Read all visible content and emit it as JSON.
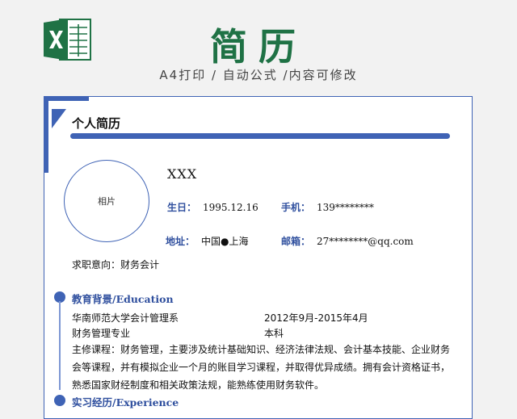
{
  "banner": {
    "title": "简历",
    "subtitle": "A4打印 / 自动公式 /内容可修改",
    "colors": {
      "excel_green": "#1f7245",
      "accent_blue": "#3f63b5"
    },
    "logo_icon": "excel-icon"
  },
  "resume": {
    "heading": "个人简历",
    "photo_label": "相片",
    "name": "XXX",
    "birth": {
      "label": "生日：",
      "value": "1995.12.16"
    },
    "phone": {
      "label": "手机：",
      "value": "139********"
    },
    "address": {
      "label": "地址：",
      "value": "中国●上海"
    },
    "email": {
      "label": "邮箱：",
      "value": "27********@qq.com"
    },
    "job_intent": "求职意向：财务会计"
  },
  "education": {
    "title": "教育背景/Education",
    "school": "华南师范大学会计管理系",
    "period": "2012年9月-2015年4月",
    "major": "财务管理专业",
    "degree": "本科",
    "courses": "主修课程：财务管理，主要涉及统计基础知识、经济法律法规、会计基本技能、企业财务会等课程，并有模拟企业一个月的账目学习课程，并取得优异成绩。拥有会计资格证书，熟悉国家财经制度和相关政策法规，能熟练使用财务软件。"
  },
  "experience": {
    "title": "实习经历/Experience"
  }
}
